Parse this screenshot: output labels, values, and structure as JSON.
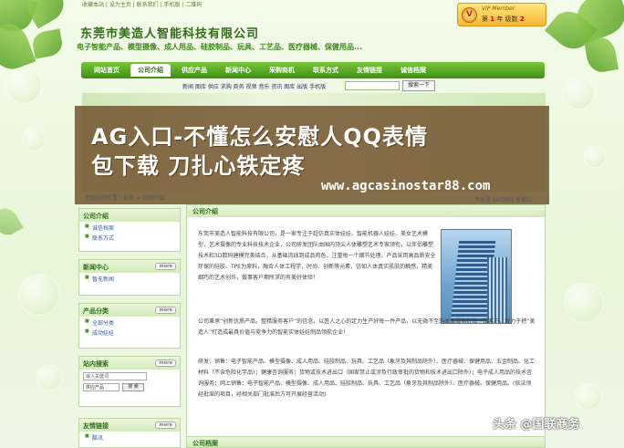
{
  "header": {
    "toplinks": "收藏本站 | 设为主页 | 联系我们 | 手机版 | 二维码",
    "company_name": "东莞市美造人智能科技有限公司",
    "tagline": "电子智能产品、模型摄像、成人用品、硅胶制品、玩具、工艺品、医疗器械、保健用品..."
  },
  "vip": {
    "title": "VIP Member",
    "badge": "V",
    "year_label": "第",
    "year_num": "1",
    "year_unit": "年",
    "level_label": "级数",
    "level_num": "2"
  },
  "nav": {
    "items": [
      "网站首页",
      "公司介绍",
      "供应产品",
      "新闻中心",
      "采购商机",
      "联系方式",
      "友情链接",
      "诚信档案"
    ],
    "active_index": 1
  },
  "subnav": {
    "links": "新闻 图库 供应 求购 商务 视频 音乐 资讯 图库 出版 手机版",
    "search_button": "搜索一下"
  },
  "overlay": {
    "title_line1": "AG入口-不懂怎么安慰人QQ表情",
    "title_line2": "包下载 刀扎心铁定疼",
    "url": "www.agcasinostar88.com"
  },
  "breadcrumb": {
    "text": "您现在的位置：首页 > 公司介绍",
    "date": "今天是 10月6日 星期三"
  },
  "sidebar": {
    "company_intro": {
      "title": "公司介绍",
      "links": [
        "诚信档案",
        "联系方式"
      ]
    },
    "news": {
      "title": "新闻中心",
      "more": "more",
      "links": [
        "暂无新闻"
      ]
    },
    "products": {
      "title": "产品分类",
      "more": "more",
      "links": [
        "全部分类",
        "成动娃娃"
      ]
    },
    "search": {
      "title": "站内搜索",
      "more": "more",
      "placeholder": "输入关键词",
      "select_value": "供应产品",
      "button": "搜 索"
    },
    "friends": {
      "title": "友情链接",
      "more": "more",
      "links": [
        "酷讯"
      ]
    }
  },
  "main": {
    "title": "公司介绍",
    "para1": "东莞市美造人智能科技有限公司，是一家专注于超仿真实体娃娃、智能机器人娃娃、美女艺术模型、艺术摄像的专业科技技术企业，公司研发团队由国内顶尖人体雕塑艺术专家领衔，以伴侣雕塑技术和3D数码建模完美结合，从基础流线到成品肉色，注重每一个细节处理。产品采用高品质安全环保的硅胶、TPE为原料，融合人体工程学，时尚、创新等元素，仿如人体真实肌肤的触感，精美细巧的艺术创作，做事客户期所求的有美好体验！",
    "para2": "公司秉承“创新优质产品，整精服务客户”的信念，以匠人之心的定力生产好每一件产品，以无微不至的关爱服务好每一位客户，致力于把“美造人”打造成最具价值与竞争力的智能实体娃娃制品领航企业！",
    "para3": "研发、销售：电子智能产品、模型摄像、成人用品、硅胶制品、玩具、工艺品（象牙及其制品除外）、医疗器械、保健用品、五金制品、化工材料（不含危险化学品）；健康咨询服务；货物或技术进出口（国家禁止或涉及行政审批的货物和技术进出口除外）；电子成人用品的技术咨询服务；网上销售：电子智能产品、模型摄像、成人用品、硅胶制品、玩具、工艺品（象牙及其制品除外）、医疗器械、保健用品。(依法须经批准的项目，经相关部门批准后方可开展经营活动)",
    "archive_title": "公司档案"
  },
  "watermark": "头条 @国联商务"
}
